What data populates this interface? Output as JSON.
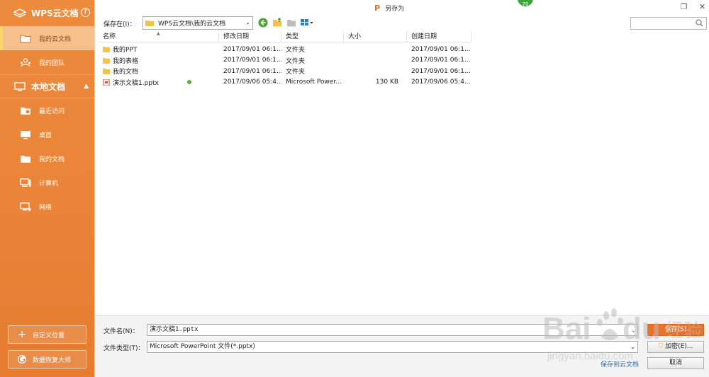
{
  "sidebar": {
    "brand": "WPS云文档",
    "help": "?",
    "items_top": [
      {
        "label": "我的云文档",
        "icon": "cloud-folder-icon"
      },
      {
        "label": "我的团队",
        "icon": "team-icon"
      }
    ],
    "section": "本地文档",
    "items_local": [
      {
        "label": "最近访问",
        "icon": "recent-icon"
      },
      {
        "label": "桌面",
        "icon": "desktop-icon"
      },
      {
        "label": "我的文档",
        "icon": "documents-icon"
      },
      {
        "label": "计算机",
        "icon": "computer-icon"
      },
      {
        "label": "网络",
        "icon": "network-icon"
      }
    ],
    "custom_location": "自定义位置",
    "recovery": "数据恢复大师"
  },
  "dialog": {
    "title": "另存为",
    "badge": "70"
  },
  "toolbar": {
    "save_in_label": "保存在(I)：",
    "path": "WPS云文档\\我的云文档",
    "search_placeholder": ""
  },
  "columns": {
    "name": "名称",
    "modified": "修改日期",
    "type": "类型",
    "size": "大小",
    "created": "创建日期"
  },
  "rows": [
    {
      "name": "我的PPT",
      "modified": "2017/09/01 06:1...",
      "type": "文件夹",
      "size": "",
      "created": "2017/09/01 06:1...",
      "kind": "folder"
    },
    {
      "name": "我的表格",
      "modified": "2017/09/01 06:1...",
      "type": "文件夹",
      "size": "",
      "created": "2017/09/01 06:1...",
      "kind": "folder"
    },
    {
      "name": "我的文档",
      "modified": "2017/09/01 06:1...",
      "type": "文件夹",
      "size": "",
      "created": "2017/09/01 06:1...",
      "kind": "folder"
    },
    {
      "name": "演示文稿1.pptx",
      "modified": "2017/09/06 05:4...",
      "type": "Microsoft Power...",
      "size": "130 KB",
      "created": "2017/09/06 05:4...",
      "kind": "pptx"
    }
  ],
  "bottom": {
    "filename_label": "文件名(N)：",
    "filename_value": "演示文稿1.pptx",
    "filetype_label": "文件类型(T)：",
    "filetype_value": "Microsoft PowerPoint 文件(*.pptx)",
    "save_button": "保存(S)",
    "encrypt_button": "加密(E)...",
    "cancel_button": "取消",
    "save_to_cloud": "保存到云文档"
  },
  "watermark": "Baidu经验 jingyan.baidu.com",
  "colors": {
    "accent": "#e8732a",
    "sidebar": "#e98337",
    "link": "#2a6db5",
    "sync": "#4fb33a"
  }
}
